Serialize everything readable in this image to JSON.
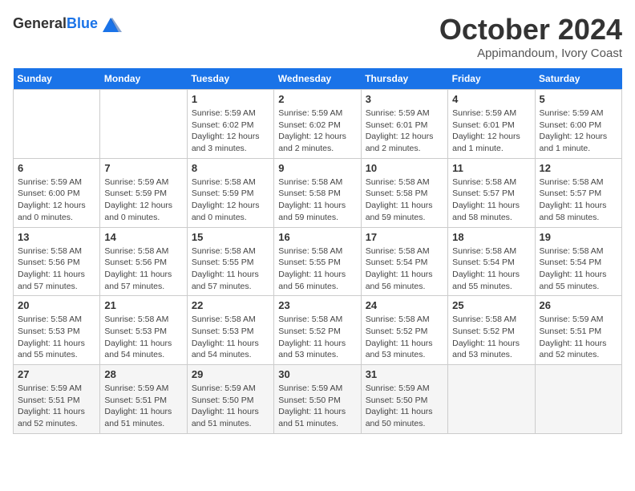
{
  "header": {
    "logo_line1": "General",
    "logo_line2": "Blue",
    "month_title": "October 2024",
    "location": "Appimandoum, Ivory Coast"
  },
  "days_of_week": [
    "Sunday",
    "Monday",
    "Tuesday",
    "Wednesday",
    "Thursday",
    "Friday",
    "Saturday"
  ],
  "weeks": [
    [
      {
        "day": "",
        "info": ""
      },
      {
        "day": "",
        "info": ""
      },
      {
        "day": "1",
        "info": "Sunrise: 5:59 AM\nSunset: 6:02 PM\nDaylight: 12 hours\nand 3 minutes."
      },
      {
        "day": "2",
        "info": "Sunrise: 5:59 AM\nSunset: 6:02 PM\nDaylight: 12 hours\nand 2 minutes."
      },
      {
        "day": "3",
        "info": "Sunrise: 5:59 AM\nSunset: 6:01 PM\nDaylight: 12 hours\nand 2 minutes."
      },
      {
        "day": "4",
        "info": "Sunrise: 5:59 AM\nSunset: 6:01 PM\nDaylight: 12 hours\nand 1 minute."
      },
      {
        "day": "5",
        "info": "Sunrise: 5:59 AM\nSunset: 6:00 PM\nDaylight: 12 hours\nand 1 minute."
      }
    ],
    [
      {
        "day": "6",
        "info": "Sunrise: 5:59 AM\nSunset: 6:00 PM\nDaylight: 12 hours\nand 0 minutes."
      },
      {
        "day": "7",
        "info": "Sunrise: 5:59 AM\nSunset: 5:59 PM\nDaylight: 12 hours\nand 0 minutes."
      },
      {
        "day": "8",
        "info": "Sunrise: 5:58 AM\nSunset: 5:59 PM\nDaylight: 12 hours\nand 0 minutes."
      },
      {
        "day": "9",
        "info": "Sunrise: 5:58 AM\nSunset: 5:58 PM\nDaylight: 11 hours\nand 59 minutes."
      },
      {
        "day": "10",
        "info": "Sunrise: 5:58 AM\nSunset: 5:58 PM\nDaylight: 11 hours\nand 59 minutes."
      },
      {
        "day": "11",
        "info": "Sunrise: 5:58 AM\nSunset: 5:57 PM\nDaylight: 11 hours\nand 58 minutes."
      },
      {
        "day": "12",
        "info": "Sunrise: 5:58 AM\nSunset: 5:57 PM\nDaylight: 11 hours\nand 58 minutes."
      }
    ],
    [
      {
        "day": "13",
        "info": "Sunrise: 5:58 AM\nSunset: 5:56 PM\nDaylight: 11 hours\nand 57 minutes."
      },
      {
        "day": "14",
        "info": "Sunrise: 5:58 AM\nSunset: 5:56 PM\nDaylight: 11 hours\nand 57 minutes."
      },
      {
        "day": "15",
        "info": "Sunrise: 5:58 AM\nSunset: 5:55 PM\nDaylight: 11 hours\nand 57 minutes."
      },
      {
        "day": "16",
        "info": "Sunrise: 5:58 AM\nSunset: 5:55 PM\nDaylight: 11 hours\nand 56 minutes."
      },
      {
        "day": "17",
        "info": "Sunrise: 5:58 AM\nSunset: 5:54 PM\nDaylight: 11 hours\nand 56 minutes."
      },
      {
        "day": "18",
        "info": "Sunrise: 5:58 AM\nSunset: 5:54 PM\nDaylight: 11 hours\nand 55 minutes."
      },
      {
        "day": "19",
        "info": "Sunrise: 5:58 AM\nSunset: 5:54 PM\nDaylight: 11 hours\nand 55 minutes."
      }
    ],
    [
      {
        "day": "20",
        "info": "Sunrise: 5:58 AM\nSunset: 5:53 PM\nDaylight: 11 hours\nand 55 minutes."
      },
      {
        "day": "21",
        "info": "Sunrise: 5:58 AM\nSunset: 5:53 PM\nDaylight: 11 hours\nand 54 minutes."
      },
      {
        "day": "22",
        "info": "Sunrise: 5:58 AM\nSunset: 5:53 PM\nDaylight: 11 hours\nand 54 minutes."
      },
      {
        "day": "23",
        "info": "Sunrise: 5:58 AM\nSunset: 5:52 PM\nDaylight: 11 hours\nand 53 minutes."
      },
      {
        "day": "24",
        "info": "Sunrise: 5:58 AM\nSunset: 5:52 PM\nDaylight: 11 hours\nand 53 minutes."
      },
      {
        "day": "25",
        "info": "Sunrise: 5:58 AM\nSunset: 5:52 PM\nDaylight: 11 hours\nand 53 minutes."
      },
      {
        "day": "26",
        "info": "Sunrise: 5:59 AM\nSunset: 5:51 PM\nDaylight: 11 hours\nand 52 minutes."
      }
    ],
    [
      {
        "day": "27",
        "info": "Sunrise: 5:59 AM\nSunset: 5:51 PM\nDaylight: 11 hours\nand 52 minutes."
      },
      {
        "day": "28",
        "info": "Sunrise: 5:59 AM\nSunset: 5:51 PM\nDaylight: 11 hours\nand 51 minutes."
      },
      {
        "day": "29",
        "info": "Sunrise: 5:59 AM\nSunset: 5:50 PM\nDaylight: 11 hours\nand 51 minutes."
      },
      {
        "day": "30",
        "info": "Sunrise: 5:59 AM\nSunset: 5:50 PM\nDaylight: 11 hours\nand 51 minutes."
      },
      {
        "day": "31",
        "info": "Sunrise: 5:59 AM\nSunset: 5:50 PM\nDaylight: 11 hours\nand 50 minutes."
      },
      {
        "day": "",
        "info": ""
      },
      {
        "day": "",
        "info": ""
      }
    ]
  ]
}
